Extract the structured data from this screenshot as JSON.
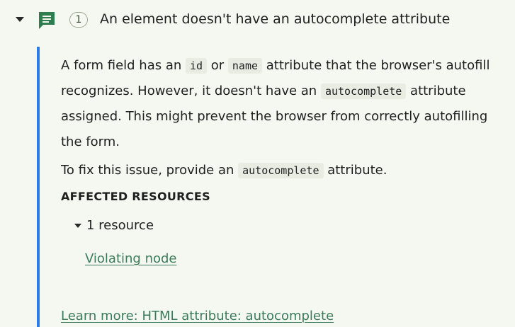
{
  "issue": {
    "title": "An element doesn't have an autocomplete attribute",
    "count": "1",
    "icon": "message-icon",
    "colors": {
      "icon": "#2e7d4f",
      "accent_bar": "#2e7be8",
      "link": "#3b7a5c",
      "background": "#f5f8f0"
    }
  },
  "description": {
    "line1_a": "A form field has an ",
    "code_id": "id",
    "line1_b": " or ",
    "code_name": "name",
    "line1_c": " attribute that the browser's autofill recognizes. However, it doesn't have an ",
    "code_autocomplete": "autocomplete",
    "line1_d": " attribute assigned. This might prevent the browser from correctly autofilling the form."
  },
  "fix": {
    "prefix": "To fix this issue, provide an ",
    "code": "autocomplete",
    "suffix": " attribute."
  },
  "affected": {
    "heading": "AFFECTED RESOURCES",
    "toggle_label": "1 resource",
    "link": "Violating node"
  },
  "learn_more": "Learn more: HTML attribute: autocomplete"
}
